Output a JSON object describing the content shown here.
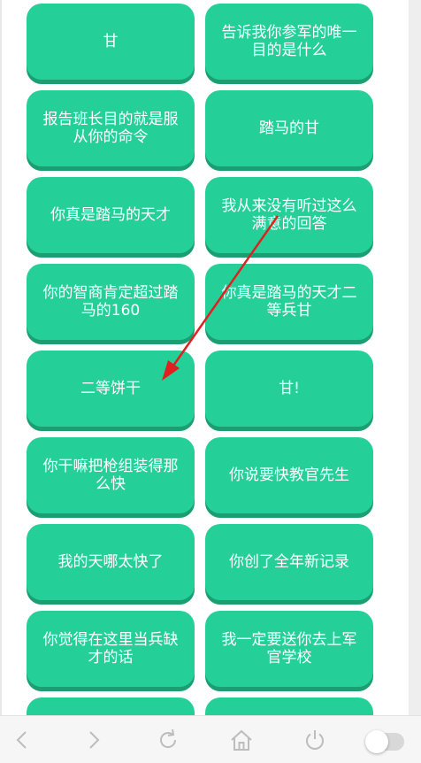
{
  "buttons": [
    {
      "label": "甘"
    },
    {
      "label": "告诉我你参军的唯一目的是什么"
    },
    {
      "label": "报告班长目的就是服从你的命令"
    },
    {
      "label": "踏马的甘"
    },
    {
      "label": "你真是踏马的天才"
    },
    {
      "label": "我从来没有听过这么满意的回答"
    },
    {
      "label": "你的智商肯定超过踏马的160"
    },
    {
      "label": "你真是踏马的天才二等兵甘"
    },
    {
      "label": "二等饼干"
    },
    {
      "label": "甘!"
    },
    {
      "label": "你干嘛把枪组装得那么快"
    },
    {
      "label": "你说要快教官先生"
    },
    {
      "label": "我的天哪太快了"
    },
    {
      "label": "你创了全年新记录"
    },
    {
      "label": "你觉得在这里当兵缺才的话"
    },
    {
      "label": "我一定要送你去上军官学校"
    },
    {
      "label": ""
    },
    {
      "label": ""
    }
  ],
  "colors": {
    "button": "#25d098",
    "button_shadow": "#1a9e72",
    "annotation_arrow": "#e02020",
    "nav_icon": "#bdbdbd"
  },
  "navbar": {
    "icons": [
      "back-icon",
      "forward-icon",
      "refresh-icon",
      "home-icon",
      "power-icon"
    ],
    "toggle": "off"
  }
}
